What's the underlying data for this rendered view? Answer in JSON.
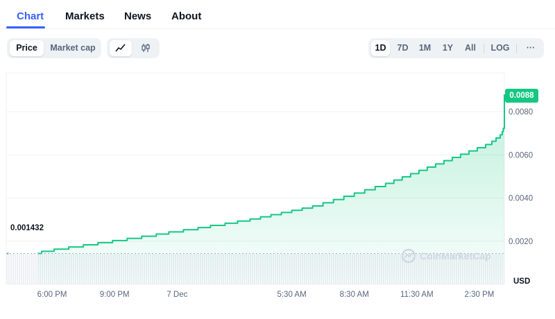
{
  "tabs": [
    {
      "label": "Chart",
      "active": true
    },
    {
      "label": "Markets",
      "active": false
    },
    {
      "label": "News",
      "active": false
    },
    {
      "label": "About",
      "active": false
    }
  ],
  "metric_toggle": {
    "price": "Price",
    "market_cap": "Market cap",
    "selected": "Price"
  },
  "chart_style_icons": [
    "line-chart-icon",
    "candlestick-icon"
  ],
  "ranges": [
    "1D",
    "7D",
    "1M",
    "1Y",
    "All"
  ],
  "selected_range": "1D",
  "log_label": "LOG",
  "more_label": "···",
  "watermark": "CoinMarketCap",
  "colors": {
    "accent": "#3861fb",
    "up": "#16c784",
    "text": "#0d1421",
    "muted": "#58667e"
  },
  "chart_data": {
    "type": "area",
    "title": "",
    "xlabel": "",
    "ylabel": "",
    "currency_label": "USD",
    "start_price_label": "0.001432",
    "current_price_label": "0.0088",
    "y_ticks": [
      "0.0020",
      "0.0040",
      "0.0060",
      "0.0080"
    ],
    "y_tick_values": [
      0.002,
      0.004,
      0.006,
      0.008
    ],
    "ylim": [
      0.0,
      0.0098
    ],
    "x_ticks": [
      "6:00 PM",
      "9:00 PM",
      "7 Dec",
      "5:30 AM",
      "8:30 AM",
      "11:30 AM",
      "2:30 PM"
    ],
    "x_tick_hours": [
      18.0,
      21.0,
      24.0,
      29.5,
      32.5,
      35.5,
      38.5
    ],
    "x_unit": "hours since 00:00 on 6 Dec",
    "xlim": [
      15.8,
      39.7
    ],
    "grid": true,
    "series": [
      {
        "values": [
          [
            17.3,
            0.00143
          ],
          [
            17.5,
            0.00153
          ],
          [
            18.1,
            0.00163
          ],
          [
            18.8,
            0.00173
          ],
          [
            19.5,
            0.00183
          ],
          [
            20.2,
            0.00193
          ],
          [
            20.9,
            0.00203
          ],
          [
            21.6,
            0.00213
          ],
          [
            22.3,
            0.00223
          ],
          [
            23.0,
            0.00233
          ],
          [
            23.6,
            0.00243
          ],
          [
            24.3,
            0.00253
          ],
          [
            25.0,
            0.00263
          ],
          [
            25.6,
            0.00273
          ],
          [
            26.3,
            0.00283
          ],
          [
            26.9,
            0.00293
          ],
          [
            27.5,
            0.00303
          ],
          [
            28.0,
            0.00313
          ],
          [
            28.5,
            0.00323
          ],
          [
            29.0,
            0.00333
          ],
          [
            29.5,
            0.00343
          ],
          [
            30.0,
            0.00353
          ],
          [
            30.5,
            0.00363
          ],
          [
            31.0,
            0.00378
          ],
          [
            31.5,
            0.00393
          ],
          [
            32.0,
            0.00408
          ],
          [
            32.5,
            0.00423
          ],
          [
            33.0,
            0.00438
          ],
          [
            33.5,
            0.00453
          ],
          [
            34.0,
            0.00468
          ],
          [
            34.4,
            0.00483
          ],
          [
            34.8,
            0.00498
          ],
          [
            35.2,
            0.00513
          ],
          [
            35.6,
            0.00528
          ],
          [
            36.0,
            0.00543
          ],
          [
            36.4,
            0.00558
          ],
          [
            36.8,
            0.00573
          ],
          [
            37.2,
            0.00588
          ],
          [
            37.6,
            0.00603
          ],
          [
            38.0,
            0.00618
          ],
          [
            38.4,
            0.00633
          ],
          [
            38.8,
            0.00648
          ],
          [
            39.1,
            0.00663
          ],
          [
            39.3,
            0.00678
          ],
          [
            39.5,
            0.00693
          ],
          [
            39.6,
            0.00708
          ],
          [
            39.65,
            0.00723
          ],
          [
            39.7,
            0.0088
          ]
        ]
      }
    ]
  }
}
